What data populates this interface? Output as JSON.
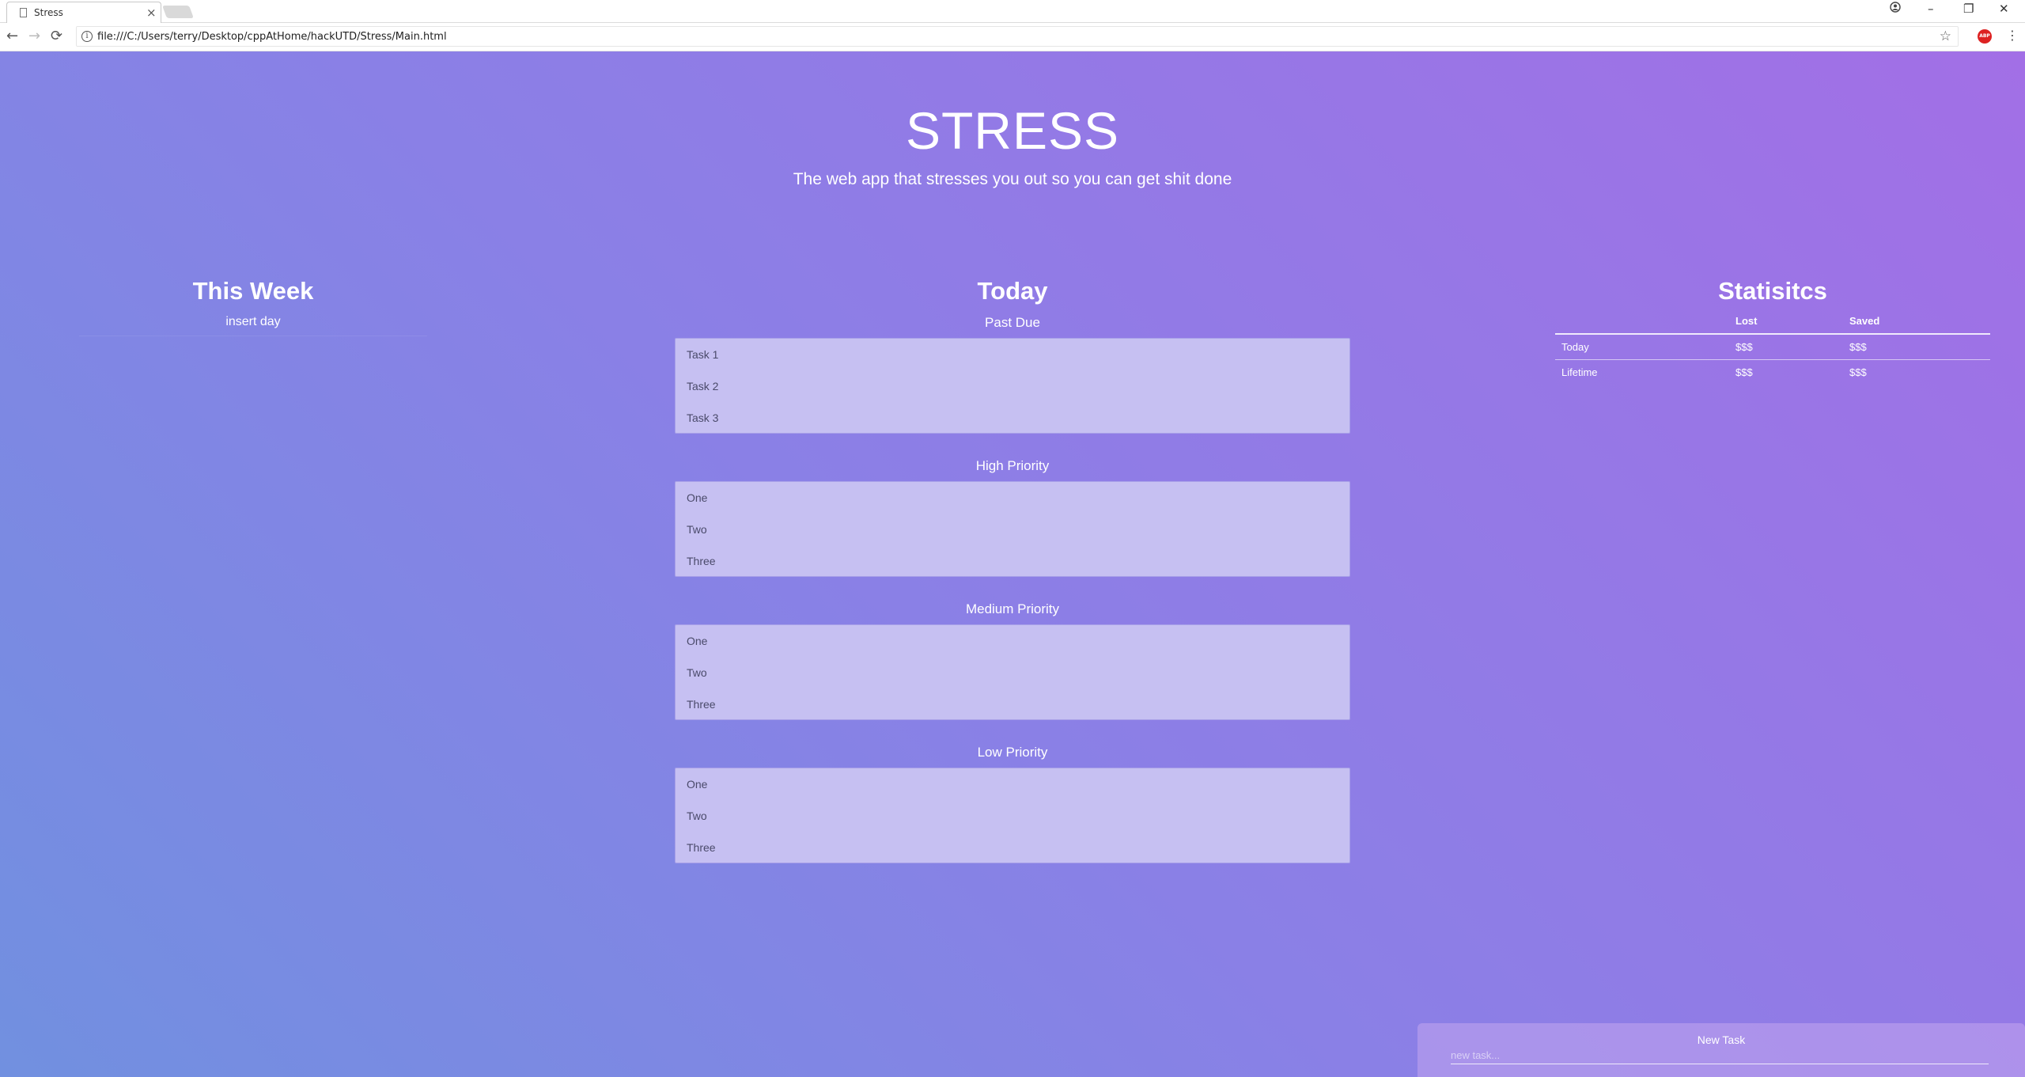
{
  "browser": {
    "tab_title": "Stress",
    "tab_close": "×",
    "url": "file:///C:/Users/terry/Desktop/cppAtHome/hackUTD/Stress/Main.html",
    "window_controls": {
      "minimize": "–",
      "restore": "❐",
      "close": "✕"
    },
    "nav": {
      "back": "←",
      "forward": "→",
      "reload": "⟳"
    },
    "abp_label": "ABP"
  },
  "header": {
    "title": "STRESS",
    "tagline": "The web app that stresses you out so you can get shit done"
  },
  "week": {
    "heading": "This Week",
    "day": "insert day"
  },
  "today": {
    "heading": "Today",
    "groups": [
      {
        "label": "Past Due",
        "tasks": [
          "Task 1",
          "Task 2",
          "Task 3"
        ]
      },
      {
        "label": "High Priority",
        "tasks": [
          "One",
          "Two",
          "Three"
        ]
      },
      {
        "label": "Medium Priority",
        "tasks": [
          "One",
          "Two",
          "Three"
        ]
      },
      {
        "label": "Low Priority",
        "tasks": [
          "One",
          "Two",
          "Three"
        ]
      }
    ]
  },
  "stats": {
    "heading": "Statisitcs",
    "columns": [
      "",
      "Lost",
      "Saved"
    ],
    "rows": [
      [
        "Today",
        "$$$",
        "$$$"
      ],
      [
        "Lifetime",
        "$$$",
        "$$$"
      ]
    ]
  },
  "new_task": {
    "title": "New Task",
    "placeholder": "new task..."
  },
  "colors": {
    "gradient_start": "#7190e0",
    "gradient_end": "#a26fe6",
    "task_box": "#c6c0f2"
  }
}
